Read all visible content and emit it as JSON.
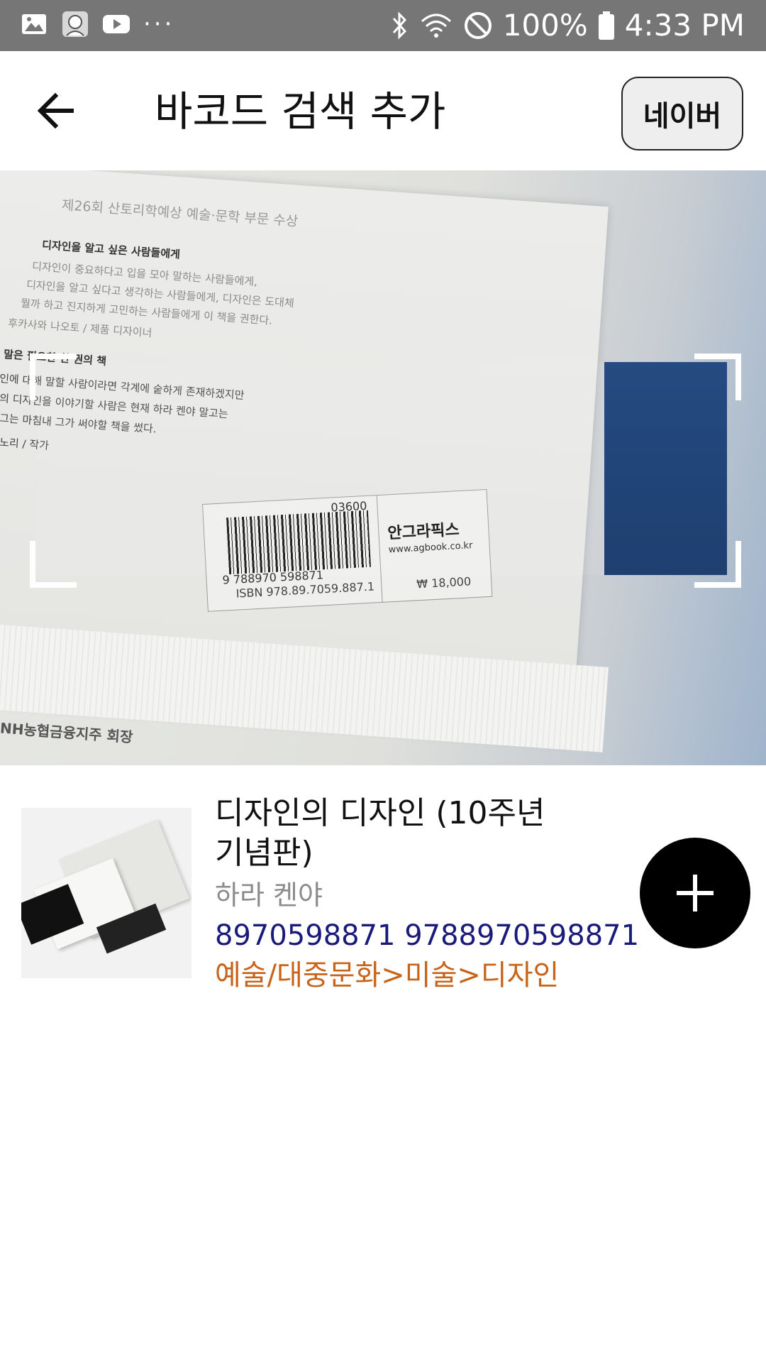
{
  "status_bar": {
    "battery": "100%",
    "time": "4:33 PM",
    "more_dots": "···",
    "icons": [
      "image-icon",
      "avatar-icon",
      "youtube-icon",
      "bluetooth-icon",
      "wifi-icon",
      "do-not-disturb-icon",
      "battery-icon"
    ]
  },
  "app_bar": {
    "title": "바코드 검색 추가",
    "back_icon": "arrow-left-icon",
    "naver_button": "네이버"
  },
  "camera_preview": {
    "book_line_1": "제26회 산토리학예상 예술·문학 부문 수상",
    "book_line_2": "디자인을 알고 싶은 사람들에게",
    "book_line_3": "디자인이 중요하다고 입을 모아 말하는 사람들에게,",
    "book_line_4": "디자인을 알고 싶다고 생각하는 사람들에게, 디자인은 도대체",
    "book_line_5": "뭘까 하고 진지하게 고민하는 사람들에게 이 책을 권한다.",
    "book_line_6": "후카사와 나오토 / 제품 디자이너",
    "book_line_7": "말은 필요한 한 권의 책",
    "book_line_8": "인에 대해 말할 사람이라면 각계에 숱하게 존재하겠지만",
    "book_line_9": "의 디자인을 이야기할 사람은 현재 하라 켄야 말고는",
    "book_line_10": "그는 마침내 그가 써야할 책을 썼다.",
    "book_line_11": "노리 / 작가",
    "barcode_top_number": "03600",
    "barcode_number": "9 788970 598871",
    "isbn": "ISBN 978.89.7059.887.1",
    "publisher": "안그라픽스",
    "publisher_site": "www.agbook.co.kr",
    "price": "₩ 18,000",
    "bottom_text": "NH농협금융지주 회장"
  },
  "result": {
    "title": "디자인의 디자인 (10주년 기념판)",
    "author": "하라 켄야",
    "isbn": "8970598871 9788970598871",
    "category": "예술/대중문화>미술>디자인",
    "add_icon": "plus-icon"
  },
  "colors": {
    "status_bar": "#767676",
    "isbn_text": "#1a1a7a",
    "category_text": "#c8641a",
    "author_text": "#8c8c8c",
    "add_button": "#000000"
  }
}
